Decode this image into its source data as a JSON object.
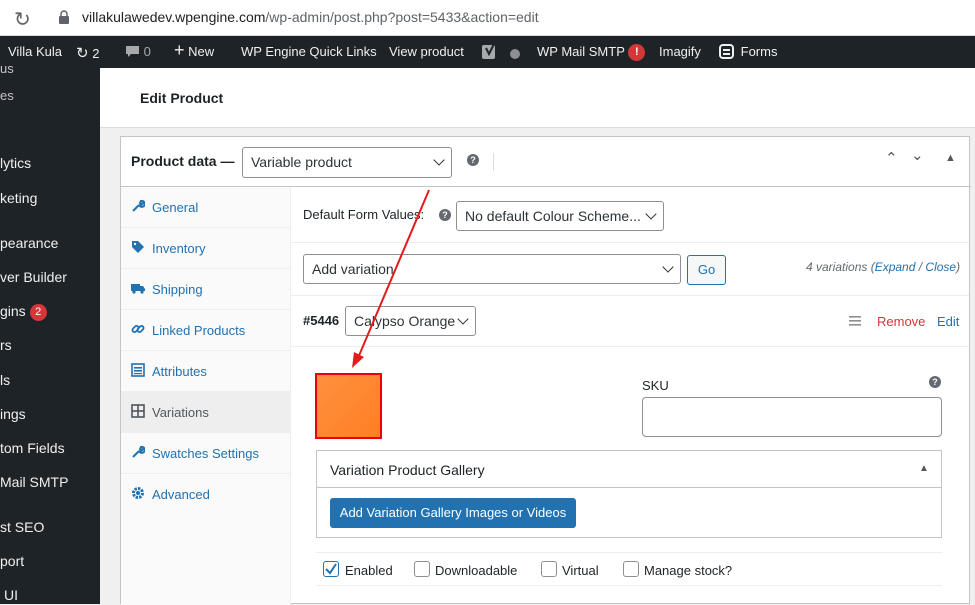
{
  "browser": {
    "url_host": "villakulawedev.wpengine.com",
    "url_path": "/wp-admin/post.php?post=5433&action=edit"
  },
  "admin_bar": {
    "site_name": "Villa Kula",
    "updates_count": "2",
    "comments_count": "0",
    "new_label": "New",
    "quick_links": "WP Engine Quick Links",
    "view_product": "View product",
    "mail_smtp": "WP Mail SMTP",
    "mail_badge": "!",
    "imagify": "Imagify",
    "forms": "Forms"
  },
  "sidebar": {
    "items": [
      {
        "label": "us"
      },
      {
        "label": "es"
      },
      {
        "label": "lytics"
      },
      {
        "label": "keting"
      },
      {
        "label": "pearance"
      },
      {
        "label": "ver Builder"
      },
      {
        "label": "gins",
        "count": "2"
      },
      {
        "label": "rs"
      },
      {
        "label": "ls"
      },
      {
        "label": "ings"
      },
      {
        "label": "tom Fields"
      },
      {
        "label": "Mail SMTP"
      },
      {
        "label": "st SEO"
      },
      {
        "label": "port"
      },
      {
        "label": "UI"
      }
    ]
  },
  "page": {
    "title": "Edit Product"
  },
  "product_data": {
    "label": "Product data —",
    "type_value": "Variable product",
    "help": "?"
  },
  "tabs": [
    {
      "label": "General",
      "icon": "wrench-icon"
    },
    {
      "label": "Inventory",
      "icon": "tag-icon"
    },
    {
      "label": "Shipping",
      "icon": "truck-icon"
    },
    {
      "label": "Linked Products",
      "icon": "link-icon"
    },
    {
      "label": "Attributes",
      "icon": "list-icon"
    },
    {
      "label": "Variations",
      "icon": "grid-icon"
    },
    {
      "label": "Swatches Settings",
      "icon": "wrench-icon"
    },
    {
      "label": "Advanced",
      "icon": "gear-icon"
    }
  ],
  "variations": {
    "default_form_label": "Default Form Values:",
    "default_form_value": "No default Colour Scheme...",
    "add_variation_value": "Add variation",
    "go_label": "Go",
    "count_text": "4 variations (",
    "expand_label": "Expand",
    "slash": " / ",
    "close_label": "Close",
    "close_paren": ")",
    "variation_id": "#5446",
    "variation_value": "Calypso Orange",
    "remove_label": "Remove",
    "edit_label": "Edit",
    "swatch_color": "#ff8a2e",
    "sku_label": "SKU",
    "gallery_title": "Variation Product Gallery",
    "gallery_button": "Add Variation Gallery Images or Videos",
    "checkboxes": [
      {
        "label": "Enabled",
        "checked": true
      },
      {
        "label": "Downloadable",
        "checked": false
      },
      {
        "label": "Virtual",
        "checked": false
      },
      {
        "label": "Manage stock?",
        "checked": false
      }
    ]
  }
}
